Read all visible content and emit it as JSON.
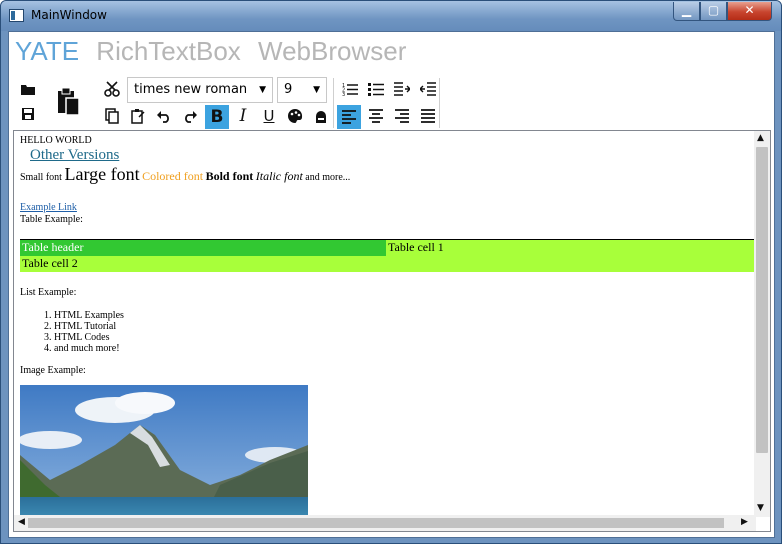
{
  "window": {
    "title": "MainWindow",
    "min_label": "▁",
    "max_label": "▢",
    "close_label": "✕"
  },
  "app_tabs": {
    "yate": "YATE",
    "richtextbox": "RichTextBox",
    "webbrowser": "WebBrowser"
  },
  "toolbar": {
    "font_family": "times new roman",
    "font_size": "9",
    "icons": [
      "open-folder-icon",
      "save-icon",
      "paste-icon",
      "cut-icon",
      "copy-icon",
      "paste-special-icon",
      "undo-icon",
      "redo-icon",
      "bold-icon",
      "italic-icon",
      "underline-icon",
      "palette-icon",
      "background-color-icon",
      "numbered-list-icon",
      "bullet-list-icon",
      "increase-indent-icon",
      "decrease-indent-icon",
      "align-left-icon",
      "align-center-icon",
      "align-right-icon",
      "justify-icon"
    ],
    "glyphs": {
      "bold": "B",
      "italic": "I",
      "underline": "U"
    },
    "accent": "#3ca3e0"
  },
  "document": {
    "heading": "HELLO WORLD",
    "other_versions": "Other Versions",
    "fonts": {
      "small": "Small font",
      "large": "Large font",
      "colored": "Colored font",
      "bold": "Bold font",
      "italic": "Italic font",
      "more": "and more..."
    },
    "example_link": "Example Link",
    "table_label": "Table Example:",
    "table": {
      "header": "Table header",
      "cell1": "Table cell 1",
      "cell2": "Table cell 2"
    },
    "list_label": "List Example:",
    "list": [
      "HTML Examples",
      "HTML Tutorial",
      "HTML Codes",
      "and much more!"
    ],
    "image_label": "Image Example:",
    "colors": {
      "link": "#1f5fa8",
      "colored_font": "#f0a020",
      "header_bg": "#32c832",
      "cell_bg": "#a8ff3a"
    }
  }
}
